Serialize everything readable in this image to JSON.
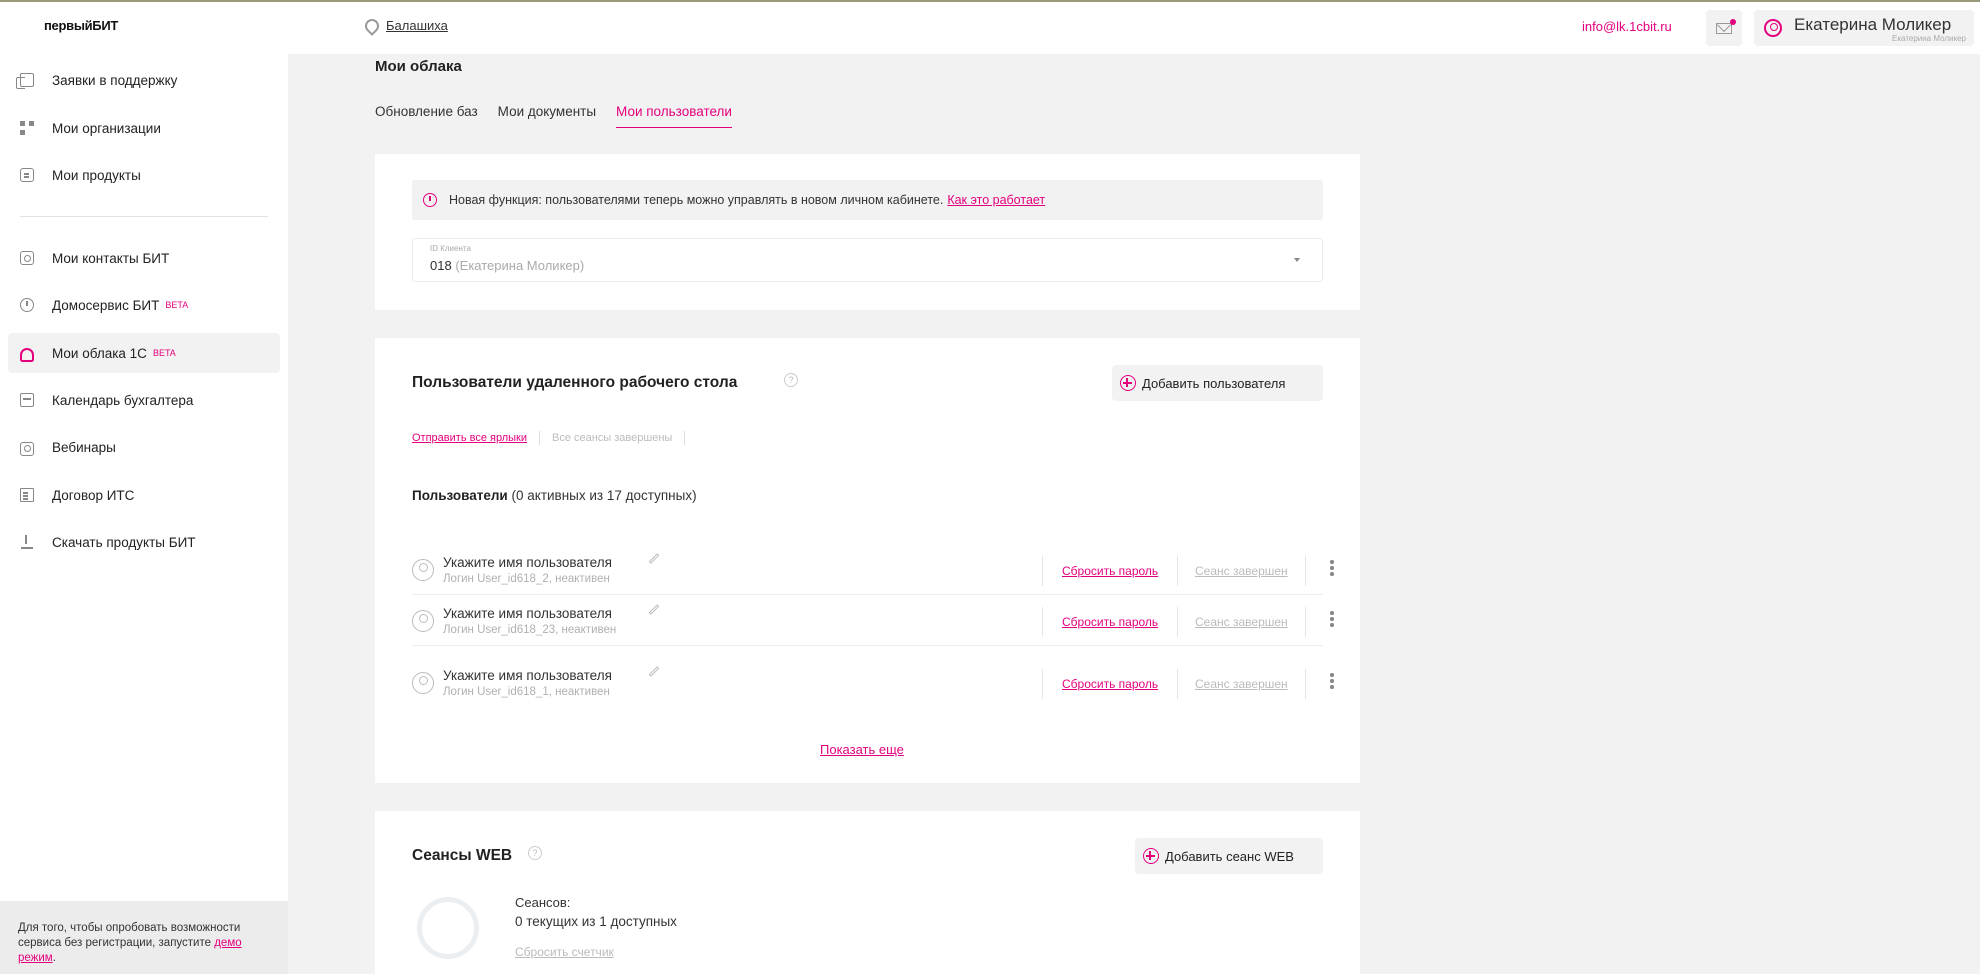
{
  "header": {
    "logo": "первыйБИТ",
    "city": "Балашиха",
    "email": "info@lk.1cbit.ru",
    "user_name": "Екатерина Моликер",
    "user_sub": "Екатерина Моликер"
  },
  "sidebar": {
    "items": [
      {
        "label": "Заявки в поддержку",
        "icon": "document-stack-icon"
      },
      {
        "label": "Мои организации",
        "icon": "grid-icon"
      },
      {
        "label": "Мои продукты",
        "icon": "box-icon"
      },
      {
        "label": "Мои контакты БИТ",
        "icon": "contact-icon"
      },
      {
        "label": "Домосервис БИТ",
        "badge": "BETA",
        "icon": "clock-icon"
      },
      {
        "label": "Мои облака 1С",
        "badge": "BETA",
        "icon": "cloud-icon",
        "active": true
      },
      {
        "label": "Календарь бухгалтера",
        "icon": "calendar-icon"
      },
      {
        "label": "Вебинары",
        "icon": "camera-icon"
      },
      {
        "label": "Договор ИТС",
        "icon": "paper-icon"
      },
      {
        "label": "Скачать продукты БИТ",
        "icon": "download-icon"
      }
    ],
    "promo_text": "Для того, чтобы опробовать возможности сервиса без регистрации, запустите ",
    "promo_link": "демо режим",
    "promo_end": "."
  },
  "main": {
    "title": "Мои облака",
    "tabs": [
      {
        "label": "Обновление баз"
      },
      {
        "label": "Мои документы"
      },
      {
        "label": "Мои пользователи",
        "active": true
      }
    ],
    "notice": {
      "text": "Новая функция: пользователями теперь можно управлять в новом личном кабинете.",
      "link": "Как это работает"
    },
    "client_select": {
      "label": "ID Клиента",
      "value": "018",
      "value_note": "(Екатерина Моликер)"
    },
    "rdp": {
      "title": "Пользователи удаленного рабочего стола",
      "add_button": "Добавить пользователя",
      "send_all_link": "Отправить все ярлыки",
      "all_sessions_ended": "Все сеансы завершены",
      "users_label": "Пользователи",
      "users_count": "(0 активных из 17 доступных)",
      "users": [
        {
          "name": "Укажите имя пользователя",
          "login": "Логин User_id618_2, неактивен",
          "reset": "Сбросить пароль",
          "status": "Сеанс завершен"
        },
        {
          "name": "Укажите имя пользователя",
          "login": "Логин User_id618_23, неактивен",
          "reset": "Сбросить пароль",
          "status": "Сеанс завершен"
        },
        {
          "name": "Укажите имя пользователя",
          "login": "Логин User_id618_1, неактивен",
          "reset": "Сбросить пароль",
          "status": "Сеанс завершен"
        }
      ],
      "show_more": "Показать еще"
    },
    "web": {
      "title": "Сеансы WEB",
      "add_button": "Добавить сеанс WEB",
      "sessions_label": "Сеансов:",
      "sessions_value": "0 текущих из 1 доступных",
      "reset_counter": "Сбросить счетчик"
    }
  },
  "colors": {
    "accent": "#e4007d",
    "background": "#f2f2f2"
  }
}
